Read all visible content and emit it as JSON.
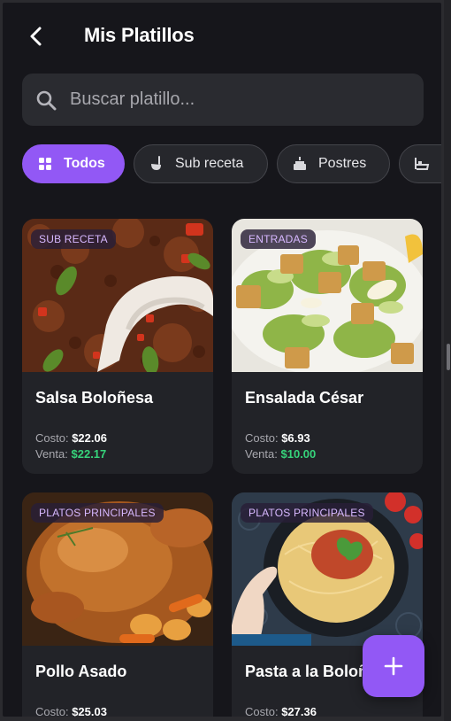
{
  "header": {
    "title": "Mis Platillos"
  },
  "search": {
    "placeholder": "Buscar platillo..."
  },
  "filters": [
    {
      "label": "Todos",
      "icon": "grid-icon",
      "active": true
    },
    {
      "label": "Sub receta",
      "icon": "ladle-icon",
      "active": false
    },
    {
      "label": "Postres",
      "icon": "cake-icon",
      "active": false
    },
    {
      "label": "",
      "icon": "bathtub-icon",
      "active": false
    }
  ],
  "cards": [
    {
      "category": "SUB RECETA",
      "name": "Salsa Boloñesa",
      "cost_label": "Costo:",
      "cost": "$22.06",
      "sale_label": "Venta:",
      "sale": "$22.17"
    },
    {
      "category": "ENTRADAS",
      "name": "Ensalada César",
      "cost_label": "Costo:",
      "cost": "$6.93",
      "sale_label": "Venta:",
      "sale": "$10.00"
    },
    {
      "category": "PLATOS PRINCIPALES",
      "name": "Pollo Asado",
      "cost_label": "Costo:",
      "cost": "$25.03"
    },
    {
      "category": "PLATOS PRINCIPALES",
      "name": "Pasta a la Boloñ",
      "cost_label": "Costo:",
      "cost": "$27.36"
    }
  ],
  "colors": {
    "accent": "#9258f5",
    "background": "#16161b",
    "card": "#222328",
    "sale": "#36d37a",
    "badge_text": "#d7b8ff"
  }
}
